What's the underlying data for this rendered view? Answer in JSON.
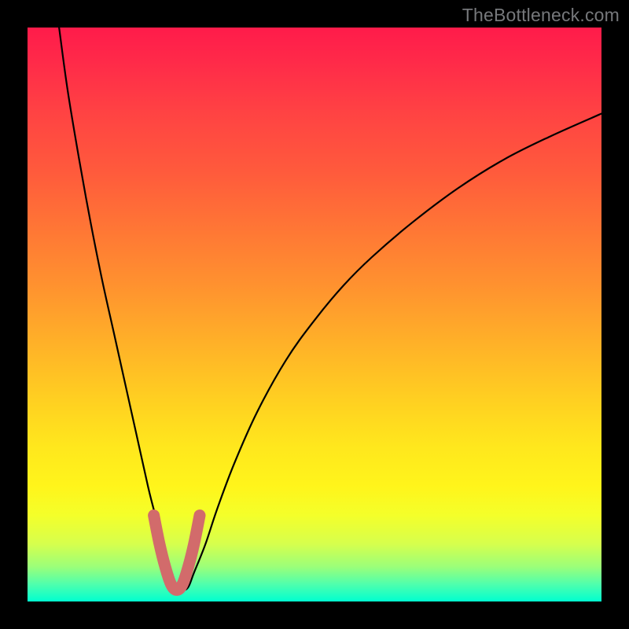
{
  "watermark": "TheBottleneck.com",
  "chart_data": {
    "type": "line",
    "title": "",
    "xlabel": "",
    "ylabel": "",
    "xlim": [
      0,
      100
    ],
    "ylim": [
      0,
      100
    ],
    "series": [
      {
        "name": "primary-curve",
        "color": "#000000",
        "x": [
          5.5,
          7,
          9,
          11,
          13,
          15,
          17,
          19,
          21,
          22,
          23,
          24,
          25,
          26,
          27,
          28,
          29,
          31,
          33,
          36,
          40,
          45,
          50,
          55,
          60,
          67,
          75,
          83,
          91,
          100
        ],
        "y": [
          100,
          89,
          77,
          66,
          56,
          47,
          38,
          29,
          20,
          16,
          12,
          8,
          5,
          2.5,
          2,
          2.5,
          5,
          10,
          16,
          24,
          33,
          42,
          49,
          55,
          60,
          66,
          72,
          77,
          81,
          85
        ]
      },
      {
        "name": "highlight-segment",
        "color": "#d26b6b",
        "x": [
          22,
          23,
          24,
          25,
          26,
          27,
          28,
          29,
          30
        ],
        "y": [
          15,
          10,
          6,
          3,
          2,
          3,
          6,
          10,
          15
        ]
      }
    ],
    "background_gradient": {
      "type": "vertical",
      "stops": [
        {
          "pos": 0.0,
          "color": "#ff1b4a"
        },
        {
          "pos": 0.5,
          "color": "#ffa82a"
        },
        {
          "pos": 0.8,
          "color": "#fff51b"
        },
        {
          "pos": 1.0,
          "color": "#00ffd0"
        }
      ]
    }
  }
}
